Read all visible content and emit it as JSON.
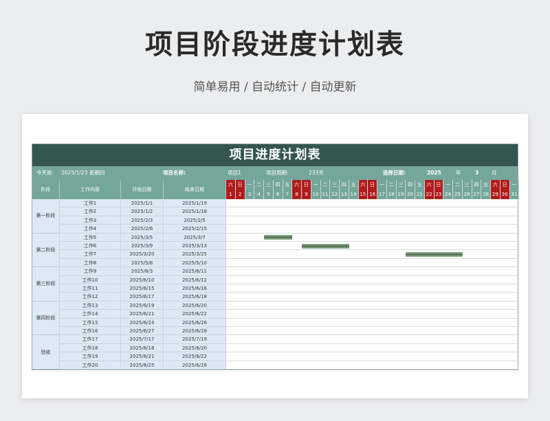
{
  "hero": {
    "title": "项目阶段进度计划表",
    "subtitle": "简单易用 / 自动统计 / 自动更新"
  },
  "sheet": {
    "title": "项目进度计划表",
    "info": {
      "today_label": "今天是:",
      "today_value": "2025/1/23 星期四",
      "name_label": "项目名称:",
      "name_value": "项目1",
      "period_label": "项目周期:",
      "period_value": "233天",
      "select_label": "选择日期:",
      "year_value": "2025",
      "year_unit": "年",
      "month_value": "3",
      "month_unit": "月"
    },
    "headers": {
      "phase": "阶段",
      "task": "工作内容",
      "start": "开始日期",
      "end": "结束日期"
    },
    "weekdays": [
      "六",
      "日",
      "一",
      "二",
      "三",
      "四",
      "五",
      "六",
      "日",
      "一",
      "二",
      "三",
      "四",
      "五",
      "六",
      "日",
      "一",
      "二",
      "三",
      "四",
      "五",
      "六",
      "日",
      "一",
      "二",
      "三",
      "四",
      "五",
      "六",
      "日",
      "一"
    ],
    "days": [
      "1",
      "2",
      "3",
      "4",
      "5",
      "6",
      "7",
      "8",
      "9",
      "10",
      "11",
      "12",
      "13",
      "14",
      "15",
      "16",
      "17",
      "18",
      "19",
      "20",
      "21",
      "22",
      "23",
      "24",
      "25",
      "26",
      "27",
      "28",
      "29",
      "30",
      "31"
    ],
    "phases": [
      {
        "label": "第一阶段",
        "rows": 4
      },
      {
        "label": "第二阶段",
        "rows": 4
      },
      {
        "label": "第三阶段",
        "rows": 4
      },
      {
        "label": "第四阶段",
        "rows": 4
      },
      {
        "label": "验收",
        "rows": 4
      }
    ],
    "tasks": [
      {
        "name": "工作1",
        "start": "2025/1/1",
        "end": "2025/1/19"
      },
      {
        "name": "工作2",
        "start": "2025/1/2",
        "end": "2025/1/18"
      },
      {
        "name": "工作3",
        "start": "2025/2/3",
        "end": "2025/2/5"
      },
      {
        "name": "工作4",
        "start": "2025/2/6",
        "end": "2025/2/15"
      },
      {
        "name": "工作5",
        "start": "2025/3/5",
        "end": "2025/3/7",
        "bar": [
          5,
          7
        ]
      },
      {
        "name": "工作6",
        "start": "2025/3/9",
        "end": "2025/3/13",
        "bar": [
          9,
          13
        ]
      },
      {
        "name": "工作7",
        "start": "2025/3/20",
        "end": "2025/3/25",
        "bar": [
          20,
          25
        ]
      },
      {
        "name": "工作8",
        "start": "2025/5/8",
        "end": "2025/5/10"
      },
      {
        "name": "工作9",
        "start": "2025/6/3",
        "end": "2025/6/11"
      },
      {
        "name": "工作10",
        "start": "2025/6/10",
        "end": "2025/6/12"
      },
      {
        "name": "工作11",
        "start": "2025/6/15",
        "end": "2025/6/16"
      },
      {
        "name": "工作12",
        "start": "2025/6/17",
        "end": "2025/6/18"
      },
      {
        "name": "工作13",
        "start": "2025/6/19",
        "end": "2025/6/20"
      },
      {
        "name": "工作14",
        "start": "2025/6/21",
        "end": "2025/6/22"
      },
      {
        "name": "工作15",
        "start": "2025/6/24",
        "end": "2025/6/26"
      },
      {
        "name": "工作16",
        "start": "2025/6/27",
        "end": "2025/6/28"
      },
      {
        "name": "工作17",
        "start": "2025/7/17",
        "end": "2025/7/19"
      },
      {
        "name": "工作18",
        "start": "2025/8/18",
        "end": "2025/8/20"
      },
      {
        "name": "工作19",
        "start": "2025/8/21",
        "end": "2025/8/22"
      },
      {
        "name": "工作20",
        "start": "2025/8/25",
        "end": "2025/6/28"
      }
    ],
    "colors": {
      "title_bg": "#355553",
      "header_bg": "#75a69b",
      "weekend_bg": "#b21b1b",
      "row_bg": "#dde9f5",
      "bar": "#4f704c"
    }
  }
}
